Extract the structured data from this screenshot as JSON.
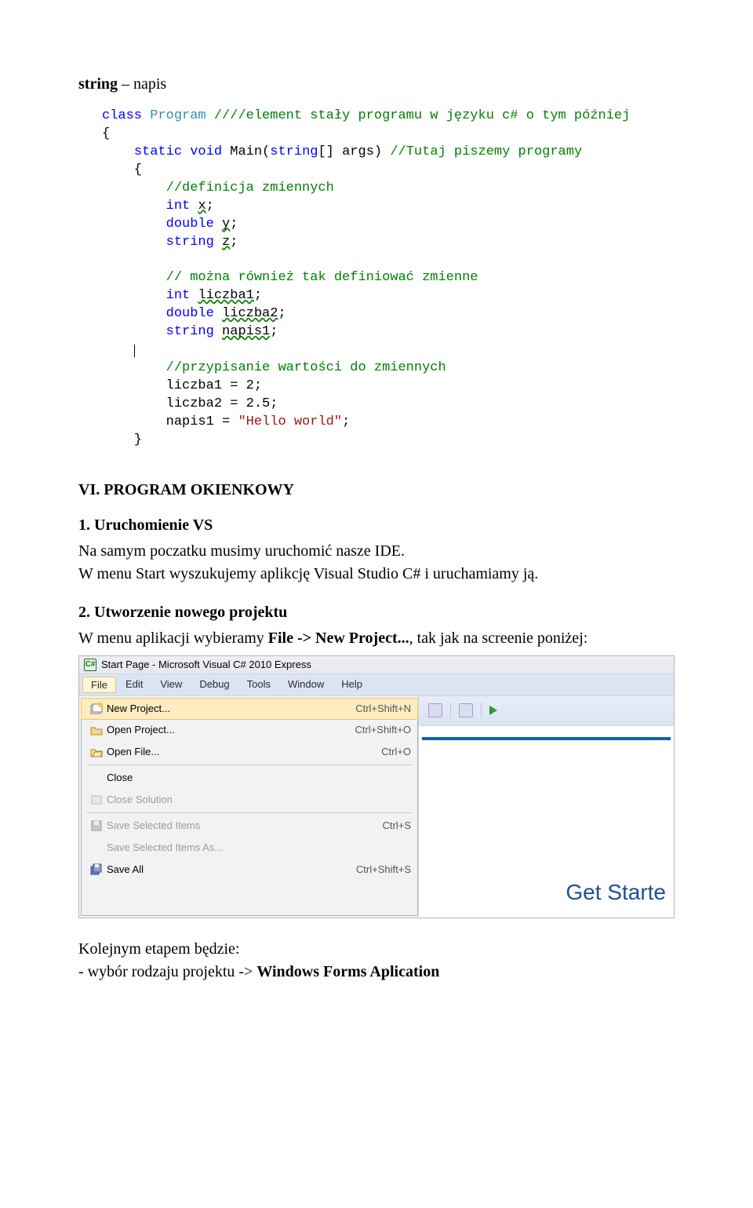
{
  "doc": {
    "top_line_prefix": "string",
    "top_line_suffix": " – napis",
    "section6_heading": "VI. PROGRAM OKIENKOWY",
    "sub1_heading": "1. Uruchomienie VS",
    "para1": "Na samym poczatku musimy uruchomić nasze IDE.",
    "para2": "W menu Start wyszukujemy aplikcję Visual Studio C# i uruchamiamy ją.",
    "sub2_heading": "2. Utworzenie nowego projektu",
    "para3_pre": "W menu aplikacji wybieramy ",
    "para3_strong": "File -> New Project...",
    "para3_post": ", tak jak na screenie poniżej:",
    "footer1": "Kolejnym etapem będzie:",
    "footer2_pre": "- wybór rodzaju projektu -> ",
    "footer2_strong": "Windows Forms Aplication"
  },
  "code": {
    "l01_a": "class",
    "l01_b": " ",
    "l01_c": "Program",
    "l01_d": " ",
    "l01_e": "////element stały programu w języku c# o tym później",
    "l02": "{",
    "l03_a": "    ",
    "l03_b": "static",
    "l03_c": " ",
    "l03_d": "void",
    "l03_e": " Main(",
    "l03_f": "string",
    "l03_g": "[] args) ",
    "l03_h": "//Tutaj piszemy programy",
    "l04": "    {",
    "l05_a": "        ",
    "l05_b": "//definicja zmiennych",
    "l06_a": "        ",
    "l06_b": "int",
    "l06_c": " ",
    "l06_d": "x",
    "l06_e": ";",
    "l07_a": "        ",
    "l07_b": "double",
    "l07_c": " ",
    "l07_d": "y",
    "l07_e": ";",
    "l08_a": "        ",
    "l08_b": "string",
    "l08_c": " ",
    "l08_d": "z",
    "l08_e": ";",
    "l09": " ",
    "l10_a": "        ",
    "l10_b": "// można również tak definiować zmienne",
    "l11_a": "        ",
    "l11_b": "int",
    "l11_c": " ",
    "l11_d": "liczba1",
    "l11_e": ";",
    "l12_a": "        ",
    "l12_b": "double",
    "l12_c": " ",
    "l12_d": "liczba2",
    "l12_e": ";",
    "l13_a": "        ",
    "l13_b": "string",
    "l13_c": " ",
    "l13_d": "napis1",
    "l13_e": ";",
    "l15_a": "        ",
    "l15_b": "//przypisanie wartości do zmiennych",
    "l16": "        liczba1 = 2;",
    "l17": "        liczba2 = 2.5;",
    "l18_a": "        napis1 = ",
    "l18_b": "\"Hello world\"",
    "l18_c": ";",
    "l19": "    }"
  },
  "vs": {
    "title": "Start Page - Microsoft Visual C# 2010 Express",
    "menu": [
      "File",
      "Edit",
      "View",
      "Debug",
      "Tools",
      "Window",
      "Help"
    ],
    "dropdown": [
      {
        "icon": "new-project-icon",
        "label": "New Project...",
        "shortcut": "Ctrl+Shift+N",
        "hover": true
      },
      {
        "icon": "open-project-icon",
        "label": "Open Project...",
        "shortcut": "Ctrl+Shift+O"
      },
      {
        "icon": "open-file-icon",
        "label": "Open File...",
        "shortcut": "Ctrl+O"
      },
      {
        "sep": true
      },
      {
        "icon": "",
        "label": "Close"
      },
      {
        "icon": "close-solution-icon",
        "label": "Close Solution",
        "disabled": true
      },
      {
        "sep": true
      },
      {
        "icon": "save-icon",
        "label": "Save Selected Items",
        "shortcut": "Ctrl+S",
        "disabled": true
      },
      {
        "icon": "",
        "label": "Save Selected Items As...",
        "disabled": true
      },
      {
        "icon": "save-all-icon",
        "label": "Save All",
        "shortcut": "Ctrl+Shift+S"
      }
    ],
    "get_started_label": "Get Starte"
  }
}
